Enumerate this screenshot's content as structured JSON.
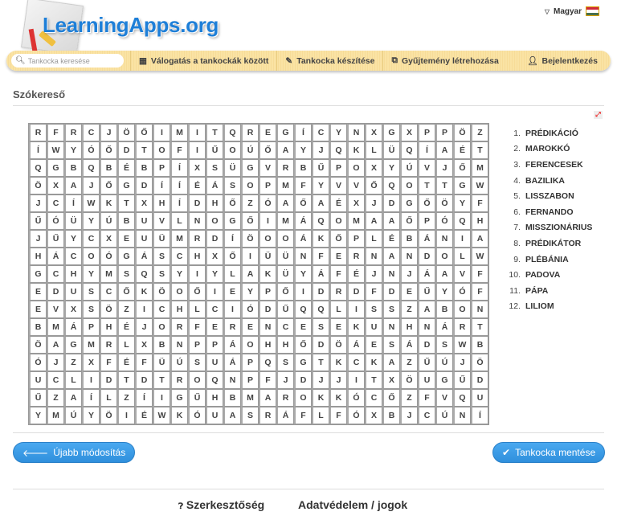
{
  "header": {
    "logo_text": "LearningApps.org",
    "language": "Magyar",
    "flag_colors": [
      "#ce2939",
      "#ffffff",
      "#477050"
    ]
  },
  "nav": {
    "search_placeholder": "Tankocka keresése",
    "browse": "Válogatás a tankockák között",
    "create": "Tankocka készítése",
    "collection": "Gyűjtemény létrehozása",
    "login": "Bejelentkezés"
  },
  "page": {
    "title": "Szókereső"
  },
  "grid": [
    "RFRCJÖŐIMITQREGÍCYNXGXPPÖZ",
    "ÍWYÓŐDTOFIŰOÚŐAYJQKLÜQÍAÉT",
    "QGBQBÉBPÍXSÜGVRBŰPOXYÚVJŐM",
    "ÖXAJŐGDÍÍÉÁSOPMFYVVŐQOTTGW",
    "JCÍWKTXHÍDHŐZÓAŐAÉXJDGŐÖYF",
    "ŰÓÜYÚBUVLNOGŐIMÁQOMAAŐPÓQH",
    "JŰYCXEUÜMRDÍÖOOÁKŐPLÉBÁNIA",
    "HÁCOÓGÁSCHXŐIÜÜNFERNANDOLW",
    "GCHYMSQSYIYLAKÜYÁFÉJNJÁAVF",
    "EDUSCŐKÖOŐIEYPŐIDRDFDEŰYÓF",
    "EVXSÖZICHLCIÓDŰQQLISSZABON",
    "BMÁPHÉJORFERENCESEKUNHNÁRT",
    "ÖAGMRLXBNPPÁOHHŐDÖÁESÁDSWB",
    "ÓJZXFÉFÜÚSUÁPQSGTKCKAZŰÚJÖ",
    "UCLIDTDTROQNPFJDJJITXÖUGŰD",
    "ŰZAÍLZÍIGŰHBMAROKKÓCŐZFVQU",
    "YMÚYÖIÉWKÓUASRÁFLFÓXBJCÚNÍ"
  ],
  "words": [
    {
      "n": "1.",
      "w": "PRÉDIKÁCIÓ"
    },
    {
      "n": "2.",
      "w": "MAROKKÓ"
    },
    {
      "n": "3.",
      "w": "FERENCESEK"
    },
    {
      "n": "4.",
      "w": "BAZILIKA"
    },
    {
      "n": "5.",
      "w": "LISSZABON"
    },
    {
      "n": "6.",
      "w": "FERNANDO"
    },
    {
      "n": "7.",
      "w": "MISSZIONÁRIUS"
    },
    {
      "n": "8.",
      "w": "PRÉDIKÁTOR"
    },
    {
      "n": "9.",
      "w": "PLÉBÁNIA"
    },
    {
      "n": "10.",
      "w": "PADOVA"
    },
    {
      "n": "11.",
      "w": "PÁPA"
    },
    {
      "n": "12.",
      "w": "LILIOM"
    }
  ],
  "buttons": {
    "back": "Újabb módosítás",
    "save": "Tankocka mentése"
  },
  "footer": {
    "editorial": "Szerkesztőség",
    "privacy": "Adatvédelem / jogok"
  }
}
